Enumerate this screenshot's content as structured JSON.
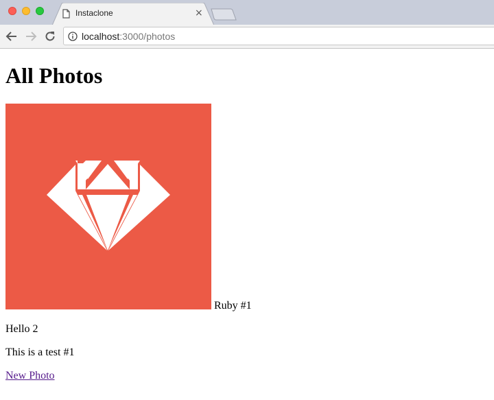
{
  "browser": {
    "tab_title": "Instaclone",
    "tab_close": "×",
    "url_host": "localhost",
    "url_path": ":3000/photos"
  },
  "page": {
    "heading": "All Photos",
    "photo": {
      "image_icon": "ruby-gem-icon",
      "image_color": "#ec5a46",
      "caption": "Ruby #1"
    },
    "paragraphs": [
      "Hello 2",
      "This is a test #1"
    ],
    "new_photo_link": "New Photo"
  },
  "colors": {
    "link_visited": "#551a8b",
    "tabstrip": "#c8cdda",
    "toolbar": "#f2f2f2"
  }
}
